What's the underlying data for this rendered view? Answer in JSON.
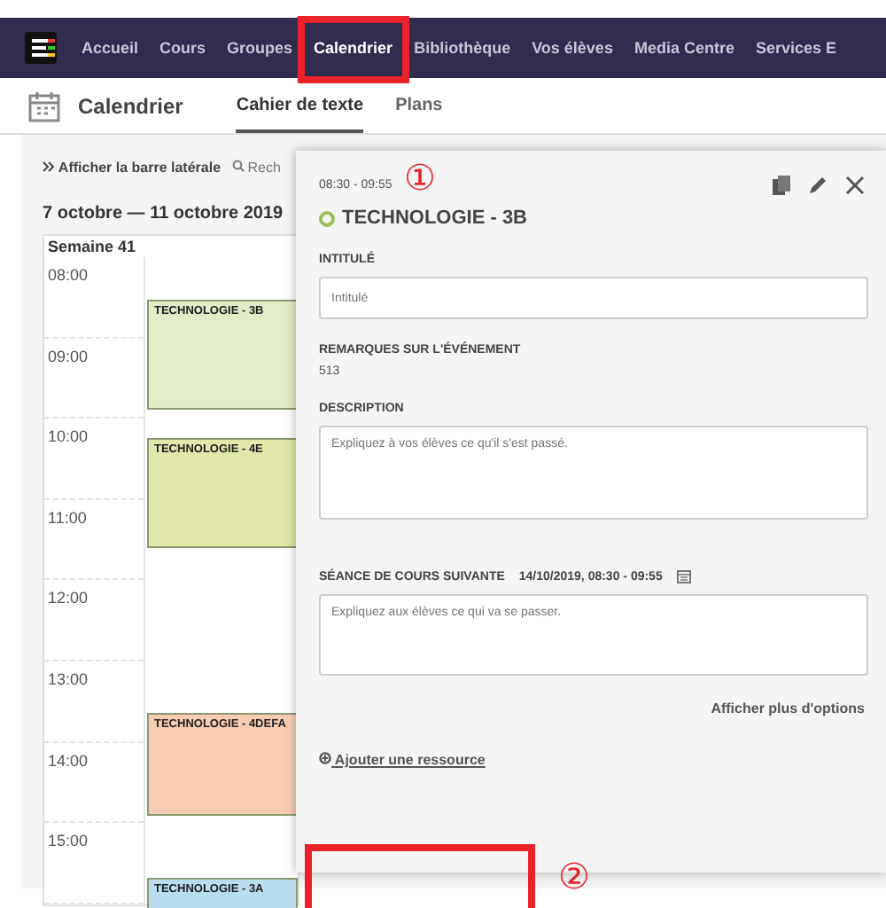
{
  "nav": {
    "items": [
      {
        "label": "Accueil",
        "selected": false
      },
      {
        "label": "Cours",
        "selected": false
      },
      {
        "label": "Groupes",
        "selected": false
      },
      {
        "label": "Calendrier",
        "selected": true
      },
      {
        "label": "Bibliothèque",
        "selected": false
      },
      {
        "label": "Vos élèves",
        "selected": false
      },
      {
        "label": "Media Centre",
        "selected": false
      },
      {
        "label": "Services E",
        "selected": false
      }
    ]
  },
  "subnav": {
    "title": "Calendrier",
    "tabs": [
      {
        "label": "Cahier de texte",
        "selected": true
      },
      {
        "label": "Plans",
        "selected": false
      }
    ]
  },
  "toolbar": {
    "sidebar_toggle": "Afficher la barre latérale",
    "search": "Rech"
  },
  "date_range": "7 octobre — 11 octobre 2019",
  "week": "Semaine 41",
  "hours": [
    "08:00",
    "09:00",
    "10:00",
    "11:00",
    "12:00",
    "13:00",
    "14:00",
    "15:00"
  ],
  "events": [
    {
      "title": "TECHNOLOGIE - 3B",
      "color": "#e2ecc9"
    },
    {
      "title": "TECHNOLOGIE - 4E",
      "color": "#e1e8a9"
    },
    {
      "title": "TECHNOLOGIE - 4DEFA",
      "color": "#f8cdb3"
    },
    {
      "title": "TECHNOLOGIE - 3A",
      "color": "#b9ddef"
    }
  ],
  "panel": {
    "time": "08:30 - 09:55",
    "title": "TECHNOLOGIE - 3B",
    "fields": [
      {
        "kind": "input",
        "label": "INTITULÉ",
        "placeholder": "Intitulé"
      },
      {
        "kind": "text",
        "label": "REMARQUES SUR L'ÉVÉNEMENT",
        "value": "513"
      },
      {
        "kind": "textarea",
        "label": "DESCRIPTION",
        "placeholder": "Expliquez à vos élèves ce qu'il s'est passé."
      },
      {
        "kind": "textarea",
        "label": "SÉANCE DE COURS SUIVANTE",
        "date": "14/10/2019, 08:30 - 09:55",
        "placeholder": "Expliquez aux élèves ce qui va se passer."
      }
    ],
    "more_options": "Afficher plus d'options",
    "add_resource": "Ajouter une ressource"
  },
  "annotations": [
    "①",
    "②"
  ]
}
